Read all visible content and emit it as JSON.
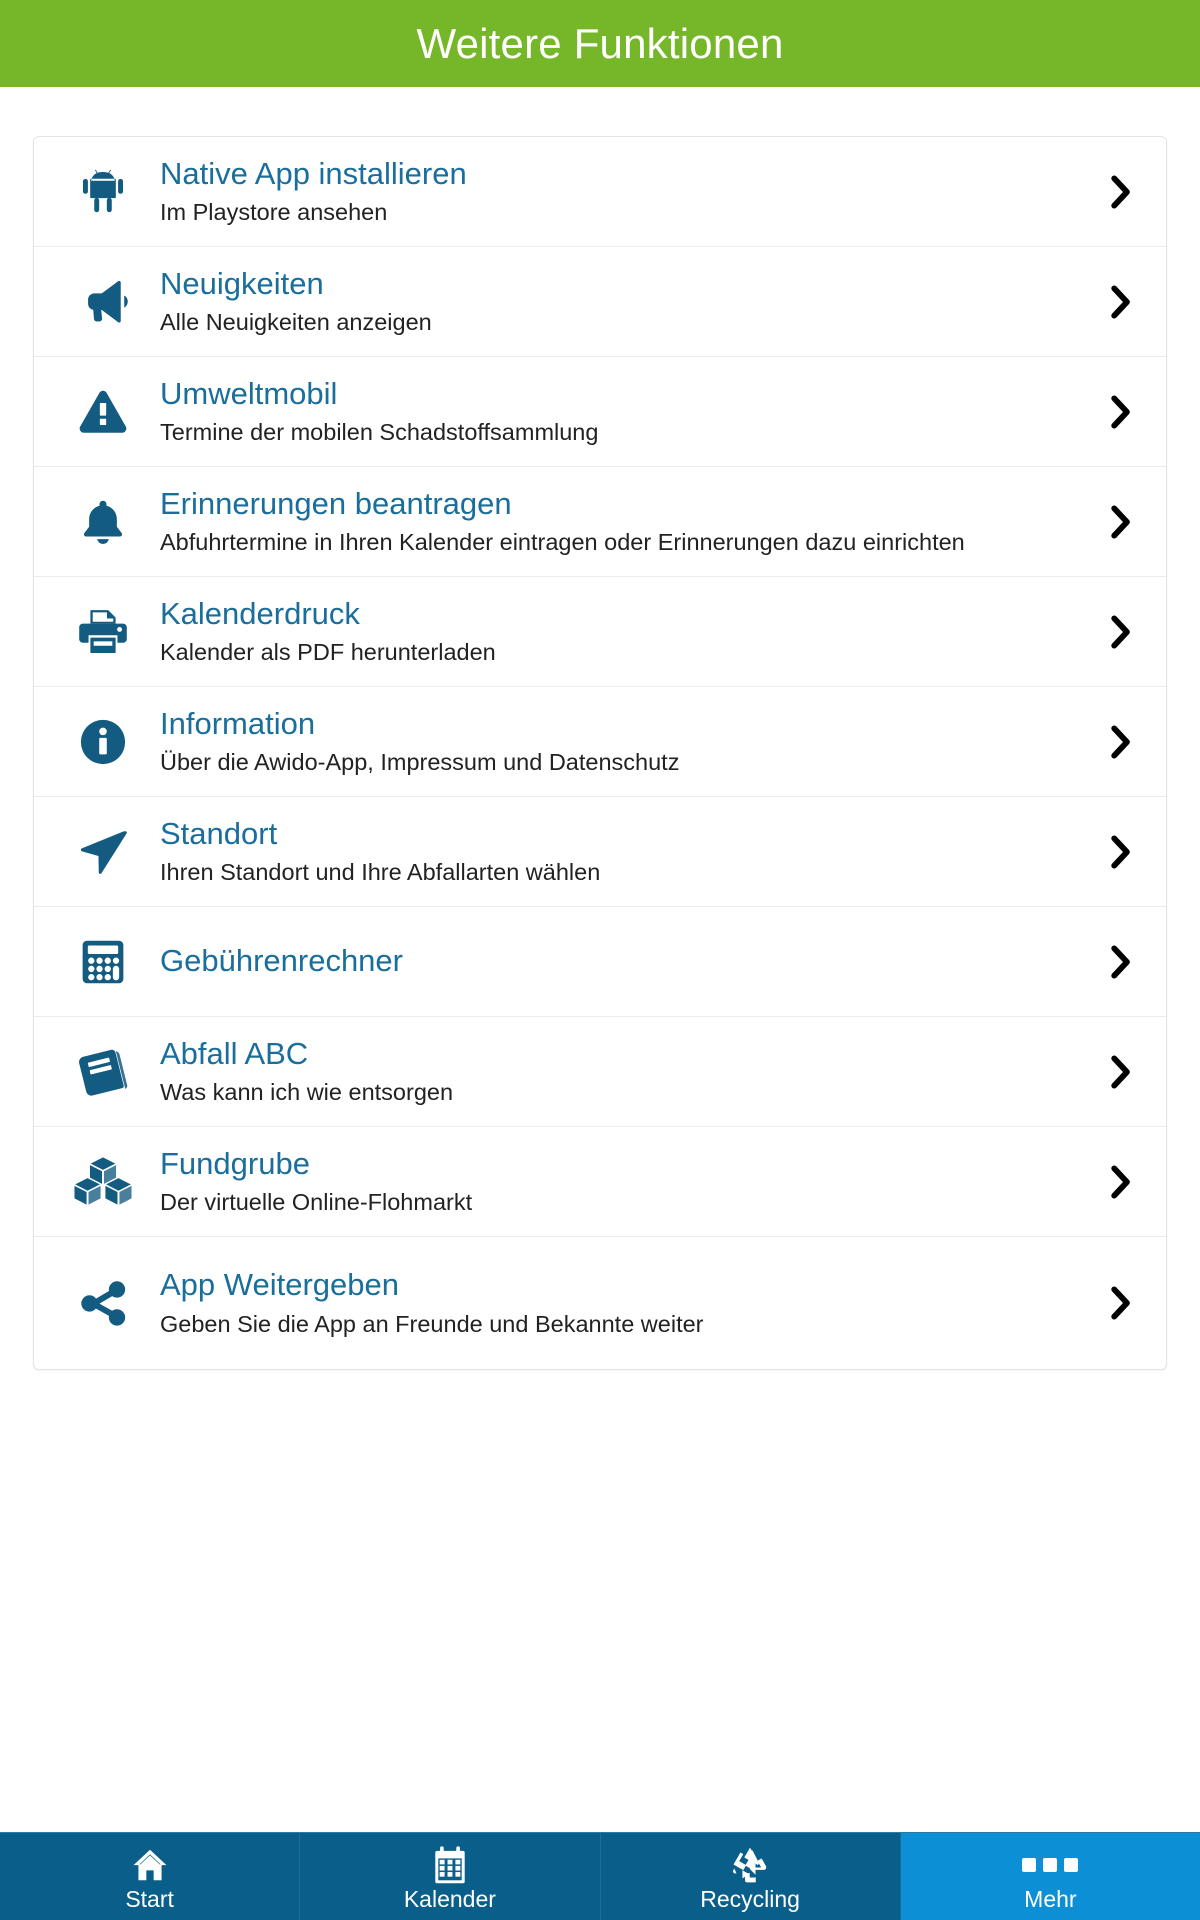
{
  "header": {
    "title": "Weitere Funktionen",
    "background_color": "#76b729",
    "text_color": "#ffffff"
  },
  "theme": {
    "title_color": "#1a6e9c",
    "icon_color": "#145b82",
    "subtitle_color": "#222222",
    "nav_background": "#0a5e8a",
    "nav_active_background": "#0c8fd5"
  },
  "list": {
    "items": [
      {
        "icon": "android-robot-icon",
        "title": "Native App installieren",
        "subtitle": "Im Playstore ansehen",
        "chevron": "chevron-right-icon"
      },
      {
        "icon": "megaphone-icon",
        "title": "Neuigkeiten",
        "subtitle": "Alle Neuigkeiten anzeigen",
        "chevron": "chevron-right-icon"
      },
      {
        "icon": "warning-triangle-icon",
        "title": "Umweltmobil",
        "subtitle": "Termine der mobilen Schadstoffsammlung",
        "chevron": "chevron-right-icon"
      },
      {
        "icon": "bell-icon",
        "title": "Erinnerungen beantragen",
        "subtitle": "Abfuhrtermine in Ihren Kalender eintragen oder Erinnerungen dazu einrichten",
        "chevron": "chevron-right-icon"
      },
      {
        "icon": "printer-icon",
        "title": "Kalenderdruck",
        "subtitle": "Kalender als PDF herunterladen",
        "chevron": "chevron-right-icon"
      },
      {
        "icon": "info-circle-icon",
        "title": "Information",
        "subtitle": "Über die Awido-App, Impressum und Datenschutz",
        "chevron": "chevron-right-icon"
      },
      {
        "icon": "location-arrow-icon",
        "title": "Standort",
        "subtitle": "Ihren Standort und Ihre Abfallarten wählen",
        "chevron": "chevron-right-icon"
      },
      {
        "icon": "calculator-icon",
        "title": "Gebührenrechner",
        "subtitle": "",
        "chevron": "chevron-right-icon"
      },
      {
        "icon": "book-icon",
        "title": "Abfall ABC",
        "subtitle": "Was kann ich wie entsorgen",
        "chevron": "chevron-right-icon"
      },
      {
        "icon": "boxes-icon",
        "title": "Fundgrube",
        "subtitle": "Der virtuelle Online-Flohmarkt",
        "chevron": "chevron-right-icon"
      },
      {
        "icon": "share-nodes-icon",
        "title": "App Weitergeben",
        "subtitle": "Geben Sie die App an Freunde und Bekannte weiter",
        "chevron": "chevron-right-icon"
      }
    ]
  },
  "bottom_nav": {
    "items": [
      {
        "label": "Start",
        "icon": "home-icon",
        "active": false
      },
      {
        "label": "Kalender",
        "icon": "calendar-icon",
        "active": false
      },
      {
        "label": "Recycling",
        "icon": "recycle-icon",
        "active": false
      },
      {
        "label": "Mehr",
        "icon": "ellipsis-icon",
        "active": true
      }
    ]
  }
}
